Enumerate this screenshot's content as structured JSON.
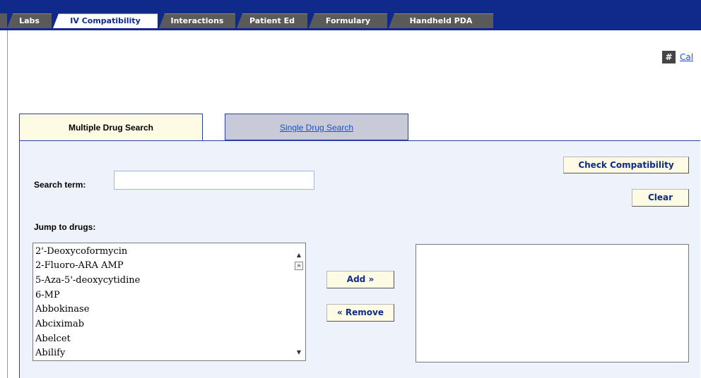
{
  "nav": {
    "tabs": [
      {
        "label": "Labs",
        "active": false
      },
      {
        "label": "IV Compatibility",
        "active": true
      },
      {
        "label": "Interactions",
        "active": false
      },
      {
        "label": "Patient Ed",
        "active": false
      },
      {
        "label": "Formulary",
        "active": false
      },
      {
        "label": "Handheld PDA",
        "active": false
      }
    ]
  },
  "calculator": {
    "icon": "#",
    "link_label": "Cal"
  },
  "search_tabs": {
    "multiple": "Multiple Drug Search",
    "single": "Single Drug Search"
  },
  "search": {
    "label": "Search term:",
    "value": "",
    "placeholder": ""
  },
  "jump": {
    "label": "Jump to drugs:"
  },
  "drug_list": [
    "2'-Deoxycoformycin",
    "2-Fluoro-ARA AMP",
    "5-Aza-5'-deoxycytidine",
    "6-MP",
    "Abbokinase",
    "Abciximab",
    "Abelcet",
    "Abilify"
  ],
  "buttons": {
    "check": "Check Compatibility",
    "clear": "Clear",
    "add": "Add »",
    "remove": "« Remove"
  },
  "colors": {
    "nav_bg": "#0f2a8a",
    "tab_inactive": "#5a5a5a",
    "panel_bg": "#edf2fb",
    "button_bg": "#fdfbe3",
    "link": "#1a4fcf"
  }
}
